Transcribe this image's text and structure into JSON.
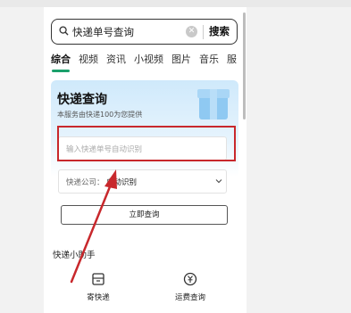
{
  "search": {
    "query": "快递单号查询",
    "button": "搜索",
    "clear_icon": "clear-icon",
    "search_icon": "search-icon"
  },
  "tabs": [
    {
      "label": "综合",
      "active": true
    },
    {
      "label": "视频"
    },
    {
      "label": "资讯"
    },
    {
      "label": "小视频"
    },
    {
      "label": "图片"
    },
    {
      "label": "音乐"
    },
    {
      "label": "服"
    }
  ],
  "card": {
    "title": "快递查询",
    "subtitle": "本服务由快递100为您提供",
    "input_placeholder": "输入快递单号自动识别",
    "company_label": "快递公司：",
    "company_value": "自动识别",
    "query_button": "立即查询"
  },
  "helper": {
    "title": "快递小助手",
    "items": [
      {
        "label": "寄快递",
        "icon": "mail-box-icon"
      },
      {
        "label": "运费查询",
        "icon": "yen-coin-icon"
      }
    ]
  },
  "colors": {
    "accent": "#1aa06b",
    "highlight": "#c8282c",
    "card_top": "#cfe9fb"
  }
}
